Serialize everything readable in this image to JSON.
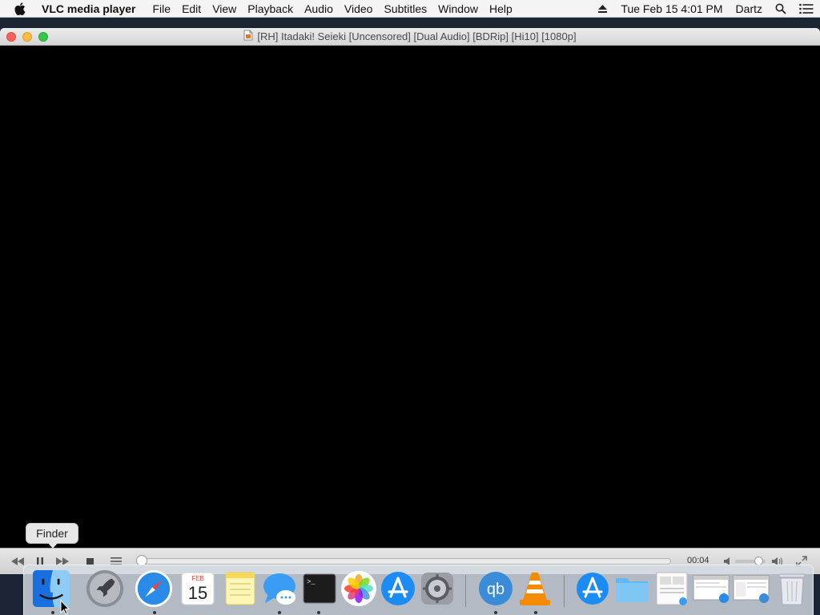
{
  "menubar": {
    "app_name": "VLC media player",
    "menus": [
      "File",
      "Edit",
      "View",
      "Playback",
      "Audio",
      "Video",
      "Subtitles",
      "Window",
      "Help"
    ],
    "clock": "Tue Feb 15  4:01 PM",
    "user": "Dartz",
    "icons": [
      "apple-icon",
      "eject-icon",
      "spotlight-search-icon",
      "notification-center-icon"
    ]
  },
  "window": {
    "title": "[RH] Itadaki! Seieki [Uncensored] [Dual Audio] [BDRip] [Hi10] [1080p]",
    "title_icon": "video-file-icon"
  },
  "controls": {
    "elapsed_time": "00:04",
    "seek_position": 0.0,
    "volume_level": 0.78,
    "buttons": [
      "rewind-icon",
      "pause-icon",
      "fast-forward-icon",
      "stop-icon",
      "playlist-icon",
      "volume-mute-icon",
      "volume-max-icon",
      "fullscreen-icon"
    ]
  },
  "tooltip": {
    "label": "Finder"
  },
  "dock": {
    "apps": [
      {
        "name": "Finder",
        "icon": "finder-icon",
        "running": true
      },
      {
        "name": "Launchpad",
        "icon": "launchpad-icon",
        "running": false
      },
      {
        "name": "Safari",
        "icon": "safari-icon",
        "running": true
      },
      {
        "name": "Calendar",
        "icon": "calendar-icon",
        "running": false,
        "month": "FEB",
        "day": "15"
      },
      {
        "name": "Notes",
        "icon": "notes-icon",
        "running": false
      },
      {
        "name": "Messages",
        "icon": "messages-icon",
        "running": true
      },
      {
        "name": "Terminal",
        "icon": "terminal-icon",
        "running": true,
        "prompt": ">_"
      },
      {
        "name": "Photos",
        "icon": "photos-icon",
        "running": false
      },
      {
        "name": "App Store",
        "icon": "app-store-icon",
        "running": false
      },
      {
        "name": "System Preferences",
        "icon": "system-preferences-icon",
        "running": false
      },
      {
        "name": "qBittorrent",
        "icon": "qbittorrent-icon",
        "running": true,
        "label": "qb"
      },
      {
        "name": "VLC",
        "icon": "vlc-icon",
        "running": true
      }
    ],
    "stacks": [
      {
        "icon": "app-store-download-icon"
      },
      {
        "icon": "folder-icon"
      },
      {
        "icon": "document-thumbnail-icon"
      },
      {
        "icon": "safari-window-thumbnail-icon"
      },
      {
        "icon": "qbittorrent-window-thumbnail-icon"
      },
      {
        "icon": "trash-icon"
      }
    ]
  },
  "colors": {
    "menubar_bg": "#f4f4f4",
    "video_bg": "#000000",
    "close": "#fc605c",
    "minimize": "#fdbc40",
    "maximize": "#34c84a",
    "vlc_orange": "#f48b00"
  }
}
